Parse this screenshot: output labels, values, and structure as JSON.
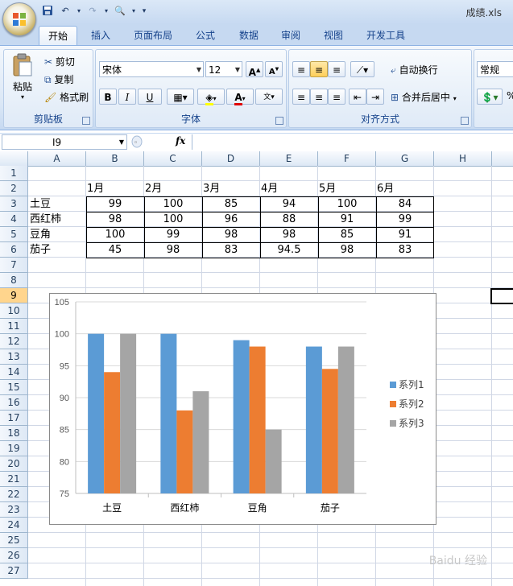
{
  "window": {
    "title": "成绩.xls"
  },
  "ribbon": {
    "tabs": [
      "开始",
      "插入",
      "页面布局",
      "公式",
      "数据",
      "审阅",
      "视图",
      "开发工具"
    ],
    "active_tab": "开始",
    "clipboard": {
      "paste": "粘贴",
      "cut": "剪切",
      "copy": "复制",
      "format_painter": "格式刷",
      "label": "剪贴板"
    },
    "font": {
      "name": "宋体",
      "size": "12",
      "bold": "B",
      "italic": "I",
      "underline": "U",
      "label": "字体"
    },
    "alignment": {
      "wrap_text": "自动换行",
      "merge_center": "合并后居中",
      "label": "对齐方式"
    },
    "number": {
      "format": "常规"
    }
  },
  "formula_bar": {
    "name_box": "I9",
    "fx": "fx",
    "formula": ""
  },
  "sheet": {
    "columns": [
      "A",
      "B",
      "C",
      "D",
      "E",
      "F",
      "G",
      "H"
    ],
    "rows": [
      "1",
      "2",
      "3",
      "4",
      "5",
      "6",
      "7",
      "8",
      "9",
      "10",
      "11",
      "12",
      "13",
      "14",
      "15",
      "16",
      "17",
      "18",
      "19",
      "20",
      "21",
      "22",
      "23",
      "24",
      "25",
      "26",
      "27"
    ],
    "selected_row": "9",
    "months": [
      "1月",
      "2月",
      "3月",
      "4月",
      "5月",
      "6月"
    ],
    "table": [
      {
        "name": "土豆",
        "values": [
          "99",
          "100",
          "85",
          "94",
          "100",
          "84"
        ]
      },
      {
        "name": "西红柿",
        "values": [
          "98",
          "100",
          "96",
          "88",
          "91",
          "99"
        ]
      },
      {
        "name": "豆角",
        "values": [
          "100",
          "99",
          "98",
          "98",
          "85",
          "91"
        ]
      },
      {
        "name": "茄子",
        "values": [
          "45",
          "98",
          "83",
          "94.5",
          "98",
          "83"
        ]
      }
    ]
  },
  "chart_data": {
    "type": "bar",
    "categories": [
      "土豆",
      "西红柿",
      "豆角",
      "茄子"
    ],
    "series": [
      {
        "name": "系列1",
        "values": [
          100,
          100,
          99,
          98
        ],
        "color": "#5b9bd5"
      },
      {
        "name": "系列2",
        "values": [
          94,
          88,
          98,
          94.5
        ],
        "color": "#ed7d31"
      },
      {
        "name": "系列3",
        "values": [
          100,
          91,
          85,
          98
        ],
        "color": "#a5a5a5"
      }
    ],
    "ylim": [
      75,
      105
    ],
    "yticks": [
      75,
      80,
      85,
      90,
      95,
      100,
      105
    ],
    "grid": true,
    "legend": "right"
  },
  "watermark": "Baidu 经验"
}
